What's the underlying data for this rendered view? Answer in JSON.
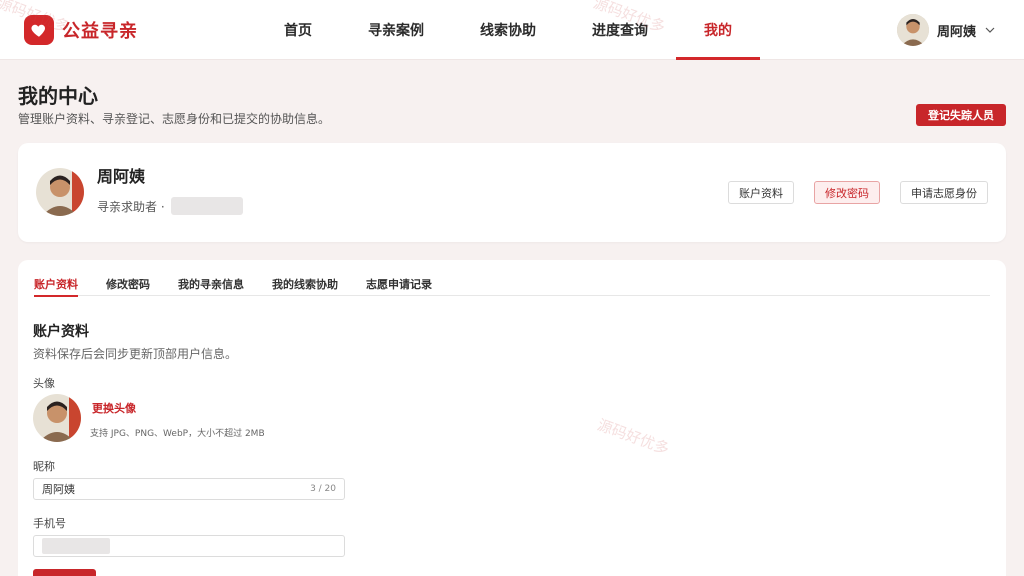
{
  "header": {
    "logo_text": "公益寻亲",
    "nav": [
      {
        "label": "首页"
      },
      {
        "label": "寻亲案例"
      },
      {
        "label": "线索协助"
      },
      {
        "label": "进度查询"
      },
      {
        "label": "我的"
      }
    ],
    "active_nav_index": 4,
    "user_name": "周阿姨"
  },
  "page": {
    "title": "我的中心",
    "subtitle": "管理账户资料、寻亲登记、志愿身份和已提交的协助信息。",
    "register_button": "登记失踪人员"
  },
  "profile": {
    "name": "周阿姨",
    "role": "寻亲求助者 ·",
    "actions": [
      "账户资料",
      "修改密码",
      "申请志愿身份"
    ]
  },
  "tabs": {
    "items": [
      "账户资料",
      "修改密码",
      "我的寻亲信息",
      "我的线索协助",
      "志愿申请记录"
    ],
    "active_index": 0
  },
  "account": {
    "title": "账户资料",
    "subtitle": "资料保存后会同步更新顶部用户信息。",
    "avatar_label": "头像",
    "change_avatar": "更换头像",
    "avatar_hint": "支持 JPG、PNG、WebP，大小不超过 2MB",
    "nickname_label": "昵称",
    "nickname_value": "周阿姨",
    "nickname_counter": "3 / 20",
    "phone_label": "手机号"
  },
  "watermark": "源码好优多",
  "colors": {
    "brand": "#c8262a",
    "background": "#f7f1f0"
  }
}
